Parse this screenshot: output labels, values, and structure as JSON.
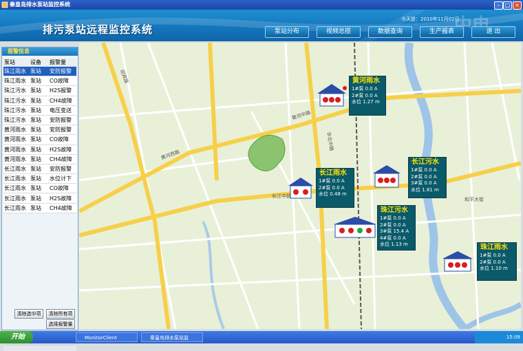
{
  "window": {
    "title": "秦皇岛排水泵站监控系统"
  },
  "header": {
    "date": "今天是：2010年11月02日",
    "system_title": "排污泵站远程监控系统",
    "watermark": "中电",
    "nav": [
      "泵站分布",
      "视频总揽",
      "数据查询",
      "生产报表",
      "退 出"
    ]
  },
  "alarm_panel": {
    "title": "报警信息",
    "columns": [
      "泵站",
      "设备",
      "报警量"
    ],
    "rows": [
      [
        "珠江雨水",
        "泵站",
        "安防报警"
      ],
      [
        "珠江雨水",
        "泵站",
        "CO故障"
      ],
      [
        "珠江污水",
        "泵站",
        "H2S报警"
      ],
      [
        "珠江污水",
        "泵站",
        "CH4故障"
      ],
      [
        "珠江污水",
        "泵站",
        "电压变送"
      ],
      [
        "珠江污水",
        "泵站",
        "安防报警"
      ],
      [
        "黄河雨水",
        "泵站",
        "安防报警"
      ],
      [
        "黄河雨水",
        "泵站",
        "CO故障"
      ],
      [
        "黄河雨水",
        "泵站",
        "H2S故障"
      ],
      [
        "黄河雨水",
        "泵站",
        "CH4故障"
      ],
      [
        "长江雨水",
        "泵站",
        "安防报警"
      ],
      [
        "长江雨水",
        "泵站",
        "水位计下"
      ],
      [
        "长江雨水",
        "泵站",
        "CO故障"
      ],
      [
        "长江雨水",
        "泵站",
        "H2S故障"
      ],
      [
        "长江雨水",
        "泵站",
        "CH4故障"
      ]
    ],
    "buttons": {
      "clear_selected": "清除选中项",
      "clear_all": "清除所有项",
      "select_alarm": "选择报警量"
    }
  },
  "stations": [
    {
      "name": "黄河雨水",
      "rows": [
        "1#泵 0.0 A",
        "2#泵 0.0 A",
        "水位 1.27 m"
      ]
    },
    {
      "name": "长江雨水",
      "rows": [
        "1#泵 0.0 A",
        "2#泵 0.0 A",
        "水位 0.48 m"
      ]
    },
    {
      "name": "长江污水",
      "rows": [
        "1#泵 0.0 A",
        "2#泵 0.0 A",
        "3#泵 0.0 A",
        "水位 1.81 m"
      ]
    },
    {
      "name": "珠江污水",
      "rows": [
        "1#泵 0.0 A",
        "2#泵 0.0 A",
        "3#泵 15.4 A",
        "4#泵 0.0 A",
        "水位 1.13 m"
      ]
    },
    {
      "name": "珠江雨水",
      "rows": [
        "1#泵 0.0 A",
        "2#泵 0.0 A",
        "水位 1.10 m"
      ]
    }
  ],
  "map_labels": {
    "huanghe_road": "黄河中路",
    "huanghe_road2": "黄河西路",
    "changjiang_road": "长江中路",
    "heping_ave": "和平大街",
    "yingbin": "迎宾路",
    "huabei": "华北中路"
  },
  "taskbar": {
    "start": "开始",
    "tasks": [
      "MonitorClient",
      "秦皇岛排水泵站监"
    ],
    "clock": "15:09"
  },
  "colors": {
    "header": "#1474bb",
    "station_panel": "#0a5a6a",
    "station_name": "#ffe100",
    "road_major": "#f6d04a",
    "water": "#9ec5e8"
  }
}
